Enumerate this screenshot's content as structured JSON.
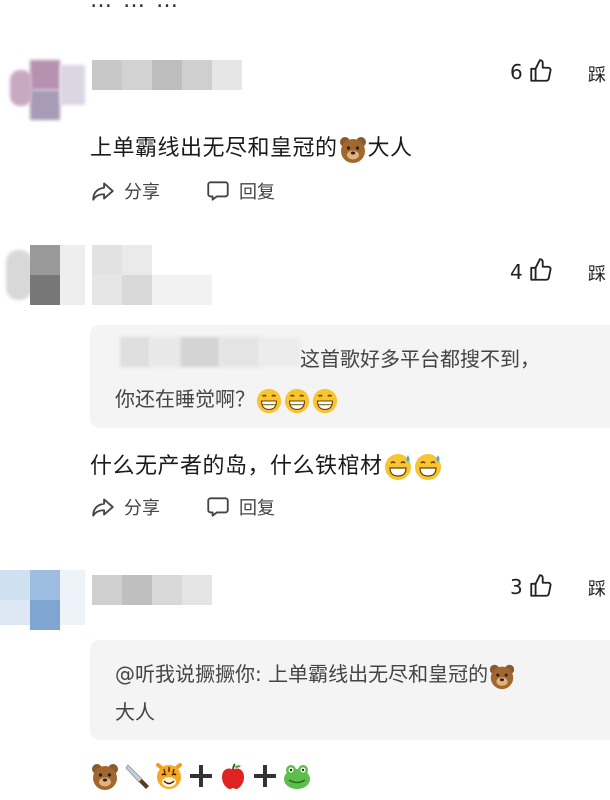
{
  "top_partial": "… … …",
  "comments": [
    {
      "likes": "6",
      "dislike_label": "踩",
      "text": "上单霸线出无尽和皇冠的",
      "text_suffix": "大人",
      "share_label": "分享",
      "reply_label": "回复"
    },
    {
      "likes": "4",
      "dislike_label": "踩",
      "quote_line1": "这首歌好多平台都搜不到，",
      "quote_line2": "你还在睡觉啊？",
      "text": "什么无产者的岛，什么铁棺材",
      "share_label": "分享",
      "reply_label": "回复"
    },
    {
      "likes": "3",
      "dislike_label": "踩",
      "quote_line1": "@听我说撅撅你: 上单霸线出无尽和皇冠的",
      "quote_line2": "大人"
    }
  ],
  "icons": {
    "thumb": "thumbs-up-icon",
    "share": "share-icon",
    "reply": "comment-icon",
    "bear": "bear-emoji",
    "grin": "beaming-face-emoji",
    "sweat": "grinning-sweat-emoji",
    "knife": "knife-emoji",
    "tiger": "tiger-emoji",
    "plus": "plus-emoji",
    "apple": "apple-emoji",
    "frog": "frog-emoji"
  }
}
